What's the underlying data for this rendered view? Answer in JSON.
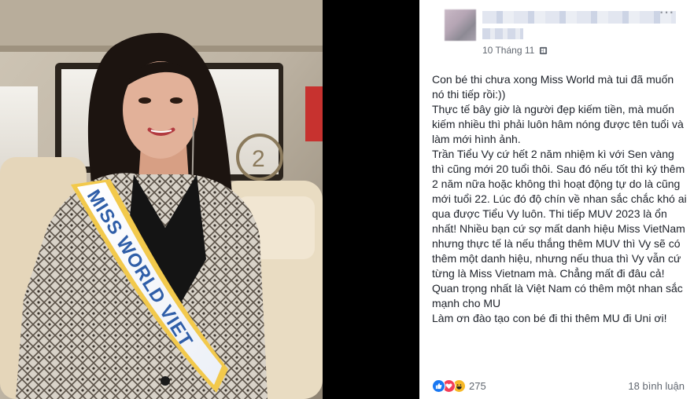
{
  "photo": {
    "sash_text": "MISS WORLD VIET"
  },
  "header": {
    "date": "10 Tháng 11",
    "more_icon": "more-dots-icon",
    "privacy_icon": "globe-icon"
  },
  "post": {
    "paragraphs": [
      "Con bé thi chưa xong Miss World mà tui đã muốn nó thi tiếp rồi:))",
      "Thực tế bây giờ là người đẹp kiếm tiền, mà muốn kiếm nhiều thì phải luôn hâm nóng được tên tuổi và làm mới hình ảnh.",
      "Trần Tiểu Vy cứ hết 2 năm nhiệm kì với Sen vàng thì cũng mới 20 tuổi thôi. Sau đó nếu tốt thì ký thêm 2 năm nữa hoặc không thì hoạt động tự do là cũng mới tuổi 22. Lúc đó độ chín về nhan sắc chắc khó ai qua được Tiểu Vy luôn. Thi tiếp MUV 2023 là ổn nhất! Nhiều bạn cứ sợ mất danh hiệu Miss VietNam nhưng thực tế là nếu thắng thêm MUV thì Vy sẽ có thêm một danh hiệu, nhưng nếu thua thì Vy vẫn cứ từng là Miss Vietnam mà. Chẳng mất đi đâu cả!",
      "Quan trọng nhất là Việt Nam có thêm một nhan sắc mạnh cho MU",
      "Làm ơn đào tạo con bé đi thi thêm MU đi Uni ơi!"
    ]
  },
  "footer": {
    "reaction_icons": [
      "like-icon",
      "love-icon",
      "haha-icon"
    ],
    "reaction_count": "275",
    "comments": "18 bình luận"
  },
  "colors": {
    "background": "#000000",
    "text": "#1d2129",
    "meta": "#616770",
    "like": "#1877f2",
    "love": "#f33e58",
    "haha": "#f7b928"
  }
}
